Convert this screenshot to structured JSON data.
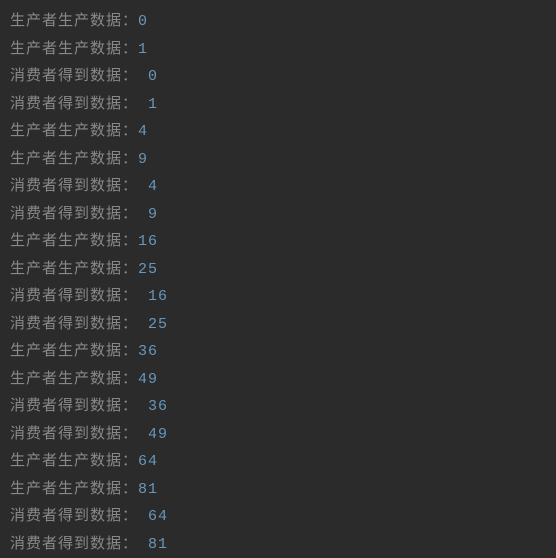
{
  "labels": {
    "producer": "生产者生产数据：",
    "consumer": "消费者得到数据： "
  },
  "lines": [
    {
      "type": "producer",
      "value": "0"
    },
    {
      "type": "producer",
      "value": "1"
    },
    {
      "type": "consumer",
      "value": "0"
    },
    {
      "type": "consumer",
      "value": "1"
    },
    {
      "type": "producer",
      "value": "4"
    },
    {
      "type": "producer",
      "value": "9"
    },
    {
      "type": "consumer",
      "value": "4"
    },
    {
      "type": "consumer",
      "value": "9"
    },
    {
      "type": "producer",
      "value": "16"
    },
    {
      "type": "producer",
      "value": "25"
    },
    {
      "type": "consumer",
      "value": "16"
    },
    {
      "type": "consumer",
      "value": "25"
    },
    {
      "type": "producer",
      "value": "36"
    },
    {
      "type": "producer",
      "value": "49"
    },
    {
      "type": "consumer",
      "value": "36"
    },
    {
      "type": "consumer",
      "value": "49"
    },
    {
      "type": "producer",
      "value": "64"
    },
    {
      "type": "producer",
      "value": "81"
    },
    {
      "type": "consumer",
      "value": "64"
    },
    {
      "type": "consumer",
      "value": "81"
    }
  ]
}
